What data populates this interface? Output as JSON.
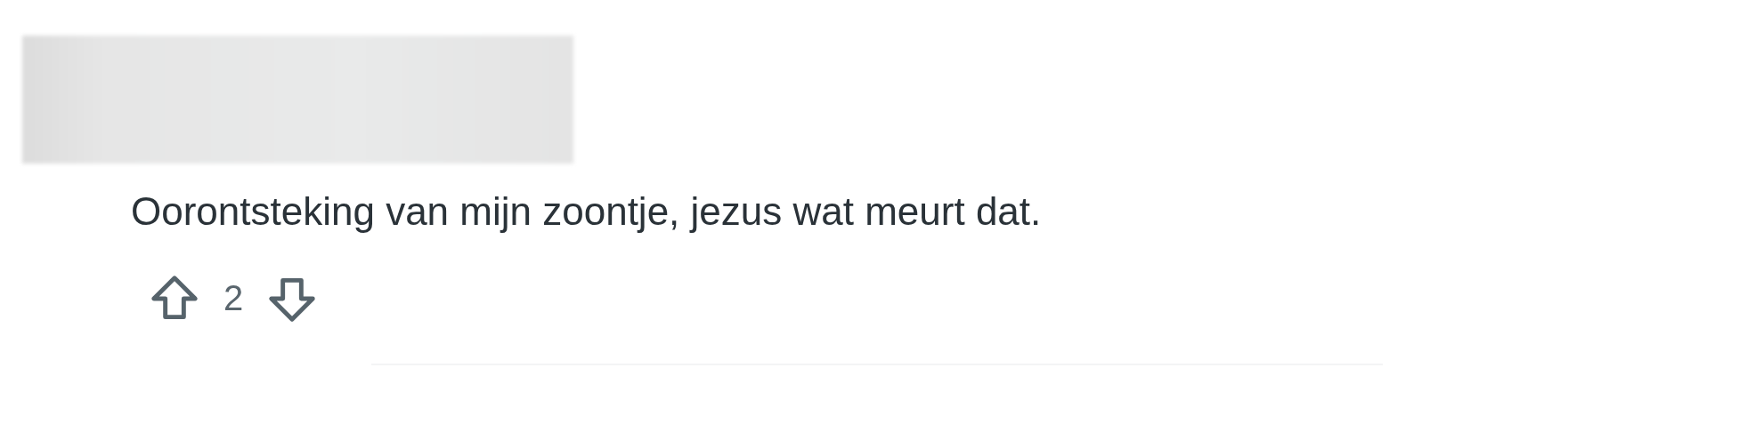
{
  "comment": {
    "text": "Oorontsteking van mijn zoontje, jezus wat meurt dat.",
    "score": "2"
  }
}
